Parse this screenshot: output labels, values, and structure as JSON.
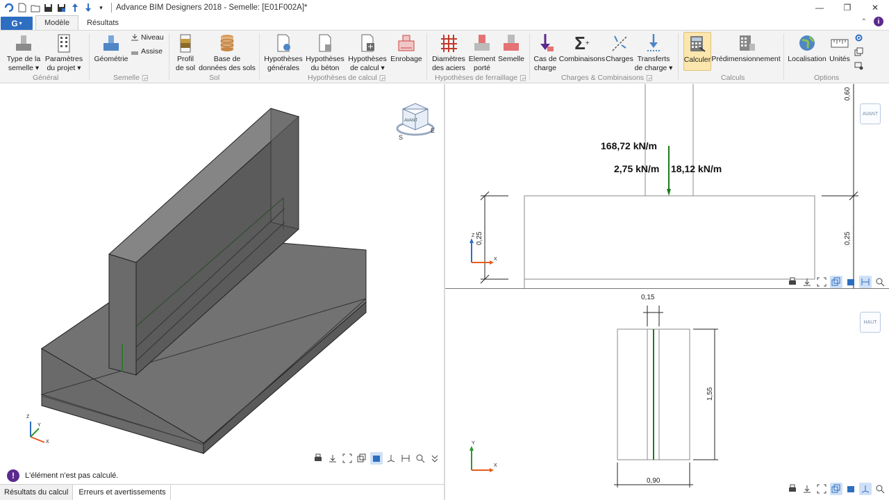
{
  "window": {
    "title": "Advance BIM Designers 2018 - Semelle: [E01F002A]*",
    "minimize": "—",
    "maximize": "❐",
    "close": "✕"
  },
  "quick_access": [
    "new-file-icon",
    "open-file-icon",
    "save-icon",
    "save-as-icon",
    "upload-icon",
    "download-icon",
    "dropdown-icon"
  ],
  "tabs": [
    {
      "label": "Modèle",
      "active": true
    },
    {
      "label": "Résultats",
      "active": false
    }
  ],
  "app_menu_label": "G",
  "ribbon": {
    "buttons": [
      {
        "id": "type",
        "label1": "Type de la",
        "label2": "semelle ▾"
      },
      {
        "id": "params",
        "label1": "Paramètres",
        "label2": "du projet ▾"
      },
      {
        "id": "geom",
        "label1": "Géométrie",
        "label2": ""
      },
      {
        "id": "profil",
        "label1": "Profil",
        "label2": "de sol"
      },
      {
        "id": "basesols",
        "label1": "Base de",
        "label2": "données des sols"
      },
      {
        "id": "hypgen",
        "label1": "Hypothèses",
        "label2": "générales"
      },
      {
        "id": "hypbeton",
        "label1": "Hypothèses",
        "label2": "du béton"
      },
      {
        "id": "hypcalc",
        "label1": "Hypothèses",
        "label2": "de calcul ▾"
      },
      {
        "id": "enrobage",
        "label1": "Enrobage",
        "label2": ""
      },
      {
        "id": "diam",
        "label1": "Diamètres",
        "label2": "des aciers"
      },
      {
        "id": "elem",
        "label1": "Element",
        "label2": "porté"
      },
      {
        "id": "semelle",
        "label1": "Semelle",
        "label2": ""
      },
      {
        "id": "cas",
        "label1": "Cas de",
        "label2": "charge"
      },
      {
        "id": "comb",
        "label1": "Combinaisons",
        "label2": ""
      },
      {
        "id": "charges",
        "label1": "Charges",
        "label2": ""
      },
      {
        "id": "transferts",
        "label1": "Transferts",
        "label2": "de charge ▾"
      },
      {
        "id": "calculer",
        "label1": "Calculer",
        "label2": ""
      },
      {
        "id": "predim",
        "label1": "Prédimensionnement",
        "label2": ""
      },
      {
        "id": "local",
        "label1": "Localisation",
        "label2": ""
      },
      {
        "id": "unites",
        "label1": "Unités",
        "label2": ""
      }
    ],
    "small": {
      "niveau": "Niveau",
      "assise": "Assise"
    },
    "groups": {
      "general": "Général",
      "semelle": "Semelle ◲",
      "sol": "Sol",
      "hypcalc": "Hypothèses de calcul ◲",
      "hypferr": "Hypothèses de ferraillage ◲",
      "charges": "Charges & Combinaisons ◲",
      "calculs": "Calculs",
      "options": "Options"
    }
  },
  "views": {
    "cube_label": "AVANT",
    "front": {
      "load1": "168,72 kN/m",
      "load2": "2,75 kN/m",
      "load3": "18,12 kN/m",
      "dim_top": "0,60",
      "dim_right": "0,25",
      "dim_left": "0,25",
      "tag": "AVANT",
      "axis_z": "Z",
      "axis_x": "X"
    },
    "top": {
      "dim_wall": "0,15",
      "dim_len": "1,55",
      "dim_width": "0,90",
      "tag": "HAUT",
      "axis_y": "Y",
      "axis_x": "X"
    },
    "iso": {
      "axis_z": "Z",
      "axis_y": "Y",
      "axis_x": "X"
    }
  },
  "status": {
    "message": "L'élément n'est pas calculé."
  },
  "bottom_tabs": [
    {
      "label": "Résultats du calcul",
      "active": true
    },
    {
      "label": "Erreurs et avertissements",
      "active": false
    }
  ],
  "colors": {
    "accent": "#2d6ec1",
    "rebar": "#1f7a1f",
    "load": "#1f7a1f",
    "highlight": "#fbe6ad"
  }
}
